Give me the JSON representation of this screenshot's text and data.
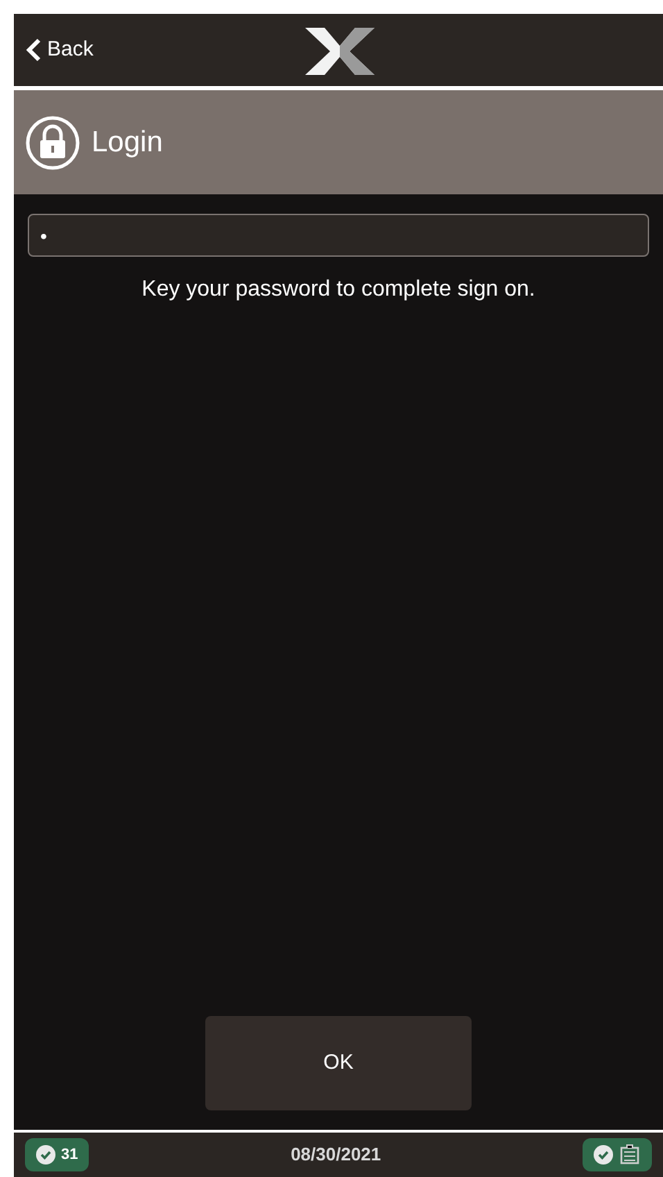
{
  "header": {
    "back_label": "Back"
  },
  "title_bar": {
    "title": "Login"
  },
  "password_field": {
    "value": "•"
  },
  "prompt": "Key your password to complete sign on.",
  "ok_button": "OK",
  "status_bar": {
    "count": "31",
    "date": "08/30/2021"
  }
}
